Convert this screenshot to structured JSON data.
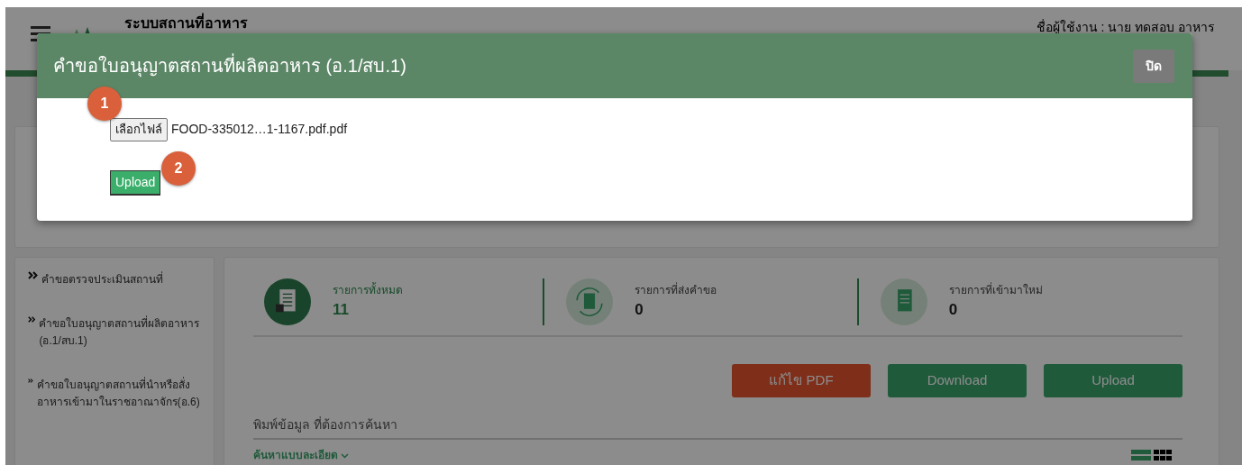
{
  "header": {
    "title": "ระบบสถานที่อาหาร",
    "user": "ชื่อผู้ใช้งาน : นาย ทดสอบ อาหาร"
  },
  "sidebar": {
    "items": [
      {
        "label": "คำขอตรวจประเมินสถานที่"
      },
      {
        "label": "คำขอใบอนุญาตสถานที่ผลิตอาหาร (อ.1/สบ.1)"
      },
      {
        "label": "คำขอใบอนุญาตสถานที่นำหรือสั่งอาหารเข้ามาในราชอาณาจักร(อ.6)"
      }
    ]
  },
  "stats": [
    {
      "label": "รายการทั้งหมด",
      "value": "11",
      "selected": true
    },
    {
      "label": "รายการที่ส่งคำขอ",
      "value": "0",
      "selected": false
    },
    {
      "label": "รายการที่เข้ามาใหม่",
      "value": "0",
      "selected": false
    }
  ],
  "actions": [
    {
      "label": "แก้ไข PDF",
      "kind": "edit"
    },
    {
      "label": "Download",
      "kind": "download"
    },
    {
      "label": "Upload",
      "kind": "upload"
    }
  ],
  "search": {
    "placeholder": "พิมพ์ข้อมูล ที่ต้องการค้นหา",
    "advanced_link": "ค้นหาแบบละเอียด"
  },
  "modal": {
    "title": "คำขอใบอนุญาตสถานที่ผลิตอาหาร (อ.1/สบ.1)",
    "close_label": "ปิด",
    "file_button": "เลือกไฟล์",
    "file_name": "FOOD-335012…1-1167.pdf.pdf",
    "upload_label": "Upload",
    "steps": [
      "1",
      "2"
    ]
  }
}
